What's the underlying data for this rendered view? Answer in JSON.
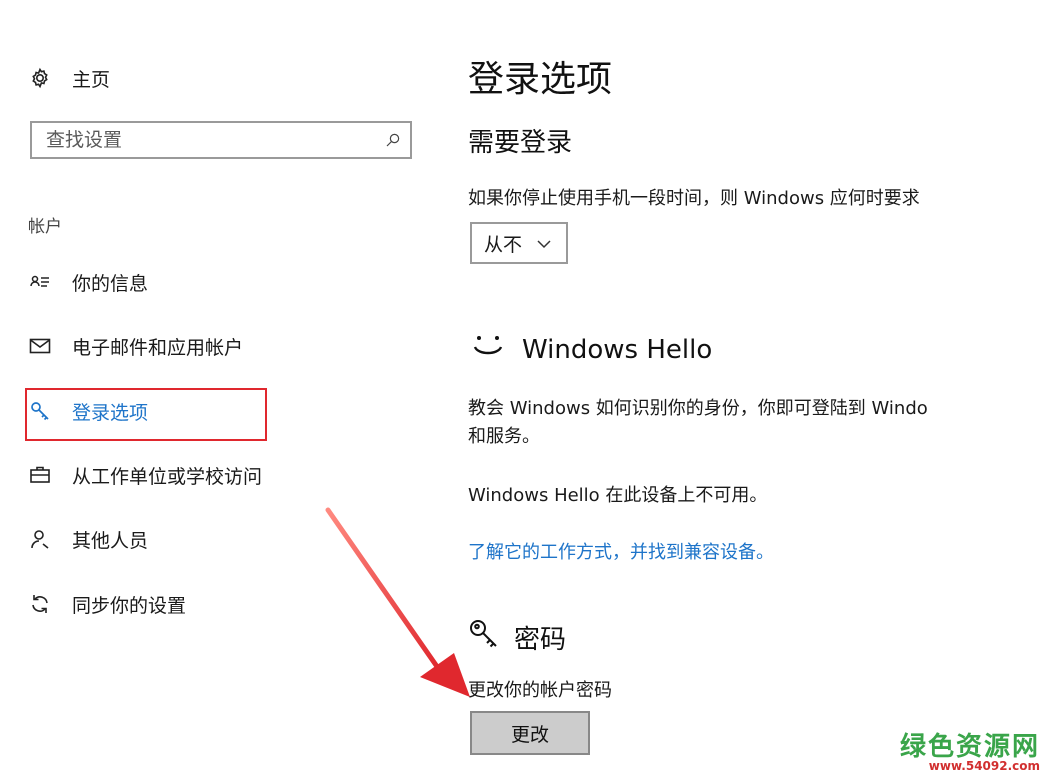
{
  "sidebar": {
    "home_label": "主页",
    "search_placeholder": "查找设置",
    "section_label": "帐户",
    "items": [
      {
        "label": "你的信息"
      },
      {
        "label": "电子邮件和应用帐户"
      },
      {
        "label": "登录选项",
        "active": true
      },
      {
        "label": "从工作单位或学校访问"
      },
      {
        "label": "其他人员"
      },
      {
        "label": "同步你的设置"
      }
    ]
  },
  "main": {
    "title": "登录选项",
    "require_signin": {
      "heading": "需要登录",
      "description": "如果你停止使用手机一段时间，则 Windows 应何时要求",
      "select_value": "从不"
    },
    "hello": {
      "heading": "Windows Hello",
      "description_line1": "教会 Windows 如何识别你的身份，你即可登陆到 Windo",
      "description_line2": "和服务。",
      "unavailable": "Windows Hello 在此设备上不可用。",
      "link": "了解它的工作方式，并找到兼容设备。"
    },
    "password": {
      "heading": "密码",
      "description": "更改你的帐户密码",
      "button": "更改"
    }
  },
  "accent_color": "#1e74c9",
  "highlight_color": "#e0282e",
  "watermark": {
    "text": "绿色资源网",
    "url": "www.54092.com"
  },
  "icons": [
    "gear-icon",
    "search-icon",
    "contact-card-icon",
    "mail-icon",
    "key-icon",
    "briefcase-icon",
    "person-icon",
    "sync-icon",
    "smiley-icon",
    "chevron-down-icon"
  ]
}
